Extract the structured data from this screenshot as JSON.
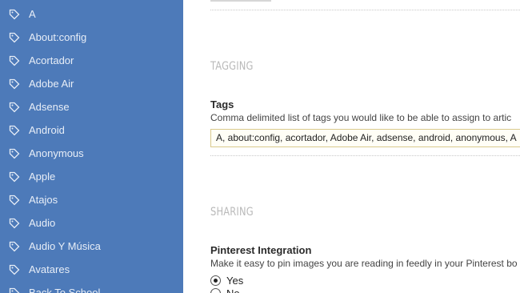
{
  "sidebar": {
    "items": [
      {
        "label": "A"
      },
      {
        "label": "About:config"
      },
      {
        "label": "Acortador"
      },
      {
        "label": "Adobe Air"
      },
      {
        "label": "Adsense"
      },
      {
        "label": "Android"
      },
      {
        "label": "Anonymous"
      },
      {
        "label": "Apple"
      },
      {
        "label": "Atajos"
      },
      {
        "label": "Audio"
      },
      {
        "label": "Audio Y Música"
      },
      {
        "label": "Avatares"
      },
      {
        "label": "Back To School"
      }
    ]
  },
  "tagging": {
    "section_title": "TAGGING",
    "label": "Tags",
    "description": "Comma delimited list of tags you would like to be able to assign to artic",
    "value": "A, about:config, acortador, Adobe Air, adsense, android, anonymous, A"
  },
  "sharing": {
    "section_title": "SHARING",
    "label": "Pinterest Integration",
    "description": "Make it easy to pin images you are reading in feedly in your Pinterest bo",
    "options": [
      {
        "label": "Yes",
        "checked": true
      },
      {
        "label": "No",
        "checked": false
      }
    ]
  },
  "colors": {
    "sidebar_bg": "#4d7ab9",
    "section_title": "#b9b9b9",
    "input_border": "#d9c98c"
  }
}
